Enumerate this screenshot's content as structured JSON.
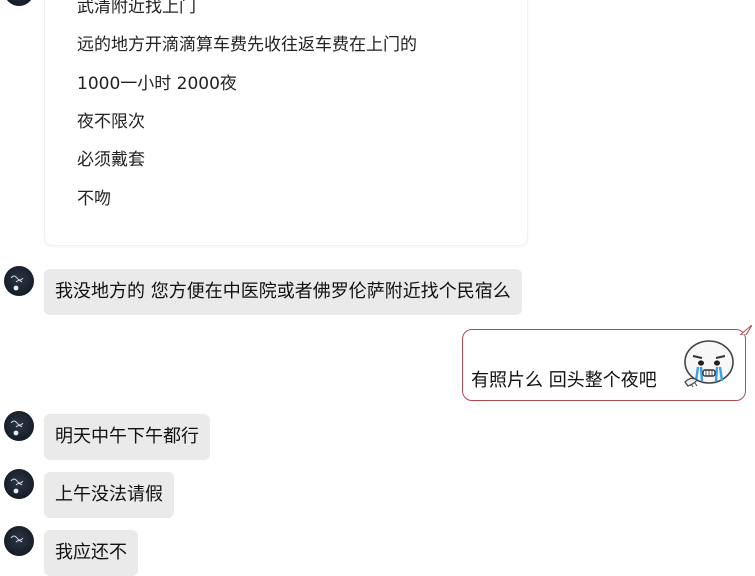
{
  "received_card": {
    "lines": [
      "武清附近找上门",
      "远的地方开滴滴算车费先收往返车费在上门的",
      "1000一小时  2000夜",
      "夜不限次",
      "必须戴套",
      "不吻"
    ]
  },
  "messages": [
    {
      "direction": "received",
      "text": "我没地方的 您方便在中医院或者佛罗伦萨附近找个民宿么"
    },
    {
      "direction": "sent",
      "text": "有照片么  回头整个夜吧",
      "sticker": "crying-face-sticker"
    },
    {
      "direction": "received",
      "text": "明天中午下午都行"
    },
    {
      "direction": "received",
      "text": "上午没法请假"
    },
    {
      "direction": "received",
      "text": "我应还不"
    }
  ],
  "colors": {
    "received_bubble": "#eaeaea",
    "sent_border": "#b44a4f",
    "avatar": "#161d27"
  }
}
